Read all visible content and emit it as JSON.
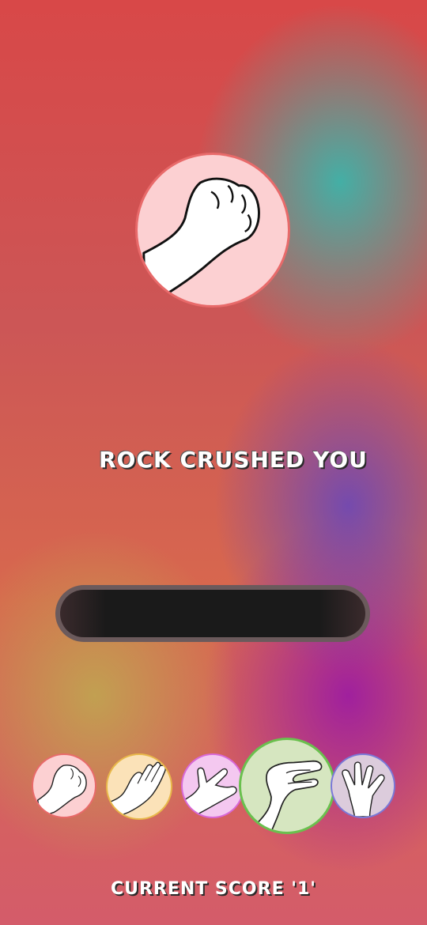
{
  "game": {
    "computer_choice": "rock",
    "result_message": "ROCK CRUSHED YOU",
    "score_text": "CURRENT SCORE '1'"
  },
  "options": [
    {
      "name": "rock",
      "icon": "fist-icon",
      "color": "#e86a6a",
      "fill": "#fcd0d2"
    },
    {
      "name": "paper",
      "icon": "open-hand-icon",
      "color": "#e8b84a",
      "fill": "#fbe2b8"
    },
    {
      "name": "scissors",
      "icon": "peace-hand-icon",
      "color": "#d868d8",
      "fill": "#f4c8f0"
    },
    {
      "name": "lizard",
      "icon": "lizard-hand-icon",
      "color": "#6ac04e",
      "fill": "#d6e6c0",
      "selected": true
    },
    {
      "name": "spock",
      "icon": "vulcan-hand-icon",
      "color": "#7a78d8",
      "fill": "#dcccdc"
    }
  ]
}
